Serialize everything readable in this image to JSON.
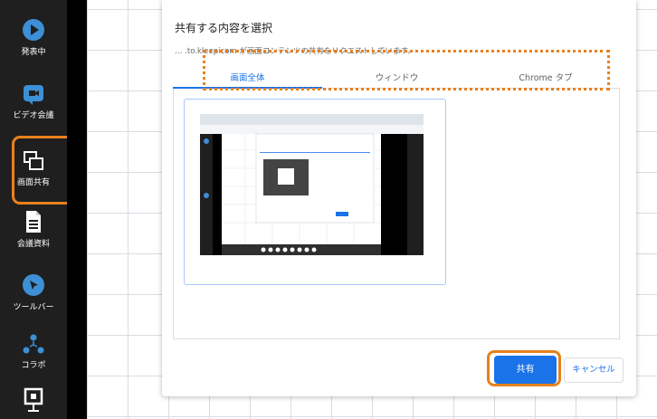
{
  "sidebar": {
    "items": [
      {
        "label": "発表中",
        "icon": "play-circle-icon"
      },
      {
        "label": "ビデオ会議",
        "icon": "video-camera-icon"
      },
      {
        "label": "画面共有",
        "icon": "screen-share-icon"
      },
      {
        "label": "会議資料",
        "icon": "document-icon"
      },
      {
        "label": "ツールバー",
        "icon": "cursor-icon"
      },
      {
        "label": "コラボ",
        "icon": "collaboration-icon"
      },
      {
        "label": "",
        "icon": "presenter-icon"
      }
    ]
  },
  "dialog": {
    "title": "共有する内容を選択",
    "subtitle": "… .to.kleepicom が画面コンテンツの共有をリクエストしています。",
    "tabs": [
      {
        "label": "画面全体",
        "active": true
      },
      {
        "label": "ウィンドウ",
        "active": false
      },
      {
        "label": "Chrome タブ",
        "active": false
      }
    ],
    "share_label": "共有",
    "cancel_label": "キャンセル"
  },
  "colors": {
    "highlight": "#e8811c",
    "accent": "#1a73e8",
    "sidebar_icon": "#3d8fd6"
  }
}
